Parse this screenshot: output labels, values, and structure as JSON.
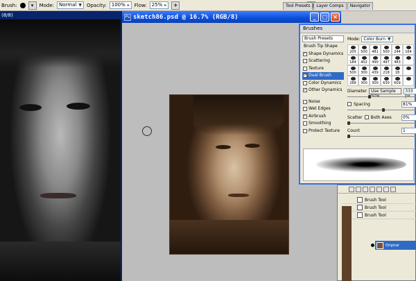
{
  "options": {
    "brush_label": "Brush:",
    "mode_label": "Mode:",
    "mode_value": "Normal",
    "opacity_label": "Opacity:",
    "opacity_value": "100%",
    "flow_label": "Flow:",
    "flow_value": "25%",
    "tabs": [
      "Tool Presets",
      "Layer Comps",
      "Navigator"
    ]
  },
  "left_doc": {
    "title": "(8/8)"
  },
  "document": {
    "title": "sketch86.psd @ 16.7% (RGB/8)"
  },
  "brushes": {
    "title": "Brushes",
    "presets_label": "Brush Presets",
    "tip_shape_label": "Brush Tip Shape",
    "settings": [
      {
        "label": "Shape Dynamics",
        "checked": true
      },
      {
        "label": "Scattering",
        "checked": false
      },
      {
        "label": "Texture",
        "checked": false
      },
      {
        "label": "Dual Brush",
        "checked": true,
        "selected": true
      },
      {
        "label": "Color Dynamics",
        "checked": false
      },
      {
        "label": "Other Dynamics",
        "checked": true
      },
      {
        "label": "Noise",
        "checked": false
      },
      {
        "label": "Wet Edges",
        "checked": false
      },
      {
        "label": "Airbrush",
        "checked": true
      },
      {
        "label": "Smoothing",
        "checked": false
      },
      {
        "label": "Protect Texture",
        "checked": false
      }
    ],
    "mode_label": "Mode:",
    "mode_value": "Color Burn",
    "tip_sizes": [
      "205",
      "500",
      "481",
      "500",
      "244",
      "164",
      "184",
      "402",
      "490",
      "497",
      "483",
      "",
      "500",
      "300",
      "439",
      "218",
      "18",
      "",
      "288",
      "300",
      "300",
      "630",
      "609",
      ""
    ],
    "diameter_label": "Diameter",
    "sample_button": "Use Sample Size",
    "diameter_value": "333 px",
    "spacing_label": "Spacing",
    "spacing_value": "81%",
    "scatter_label": "Scatter",
    "both_axes_label": "Both Axes",
    "scatter_value": "0%",
    "count_label": "Count",
    "count_value": "1"
  },
  "layers": {
    "history": [
      "Brush Tool",
      "Brush Tool",
      "Brush Tool"
    ],
    "active_layer": "Original"
  },
  "colors": {
    "title_blue": "#0a4ed8",
    "selection": "#316ac5",
    "panel": "#ece9d8"
  }
}
